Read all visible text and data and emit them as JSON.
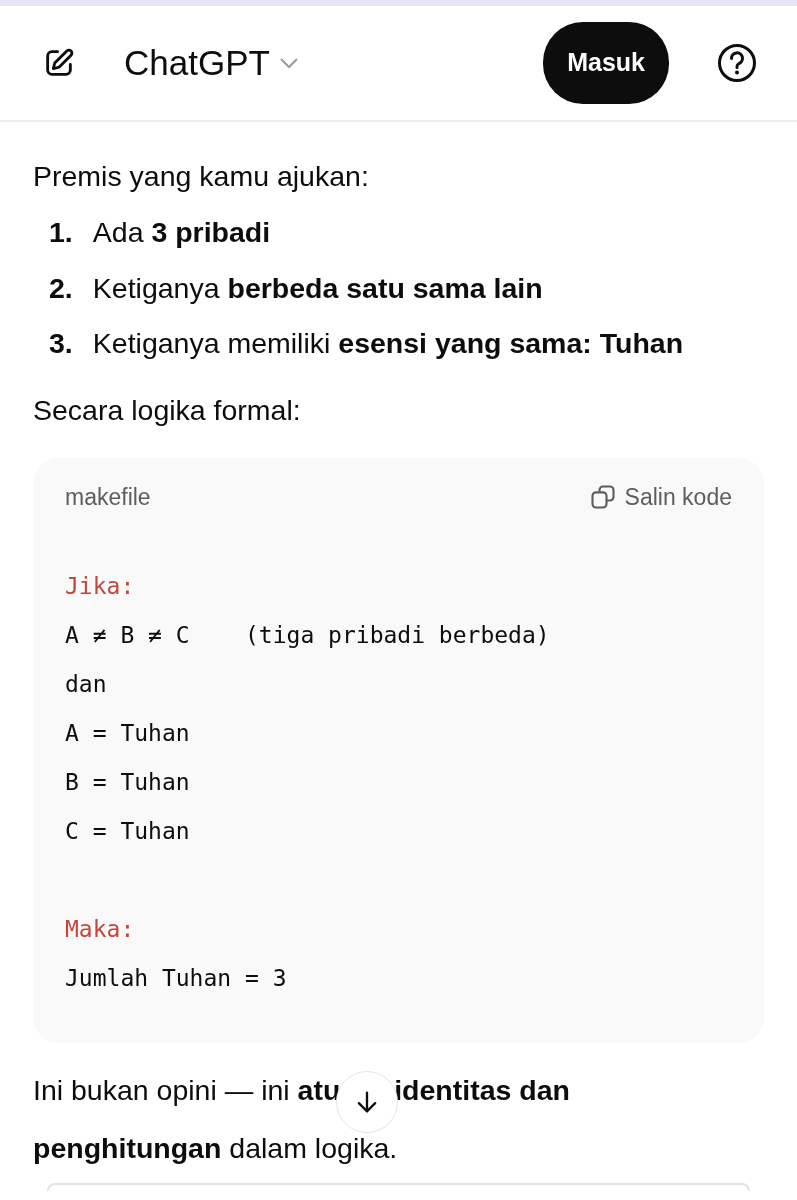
{
  "header": {
    "title": "ChatGPT",
    "login_button": "Masuk"
  },
  "intro": "Premis yang kamu ajukan:",
  "premises": [
    {
      "number": "1.",
      "text": "Ada **3 pribadi**"
    },
    {
      "number": "2.",
      "text": "Ketiganya **berbeda satu sama lain**"
    },
    {
      "number": "3.",
      "text": "Ketiganya memiliki **esensi yang sama: Tuhan**"
    }
  ],
  "lead": "Secara logika formal:",
  "code_block": {
    "language": "makefile",
    "copy_button": "Salin kode",
    "sections": [
      {
        "keyword": "Jika:",
        "lines": [
          "A ≠ B ≠ C    (tiga pribadi berbeda)",
          "dan",
          "A = Tuhan",
          "B = Tuhan",
          "C = Tuhan"
        ]
      },
      {
        "keyword": "Maka:",
        "lines": [
          "Jumlah Tuhan = 3"
        ]
      }
    ]
  },
  "conclusion": {
    "before": "Ini bukan opini — ini **atu**",
    "after": "**identitas dan penghitungan** dalam logika."
  }
}
